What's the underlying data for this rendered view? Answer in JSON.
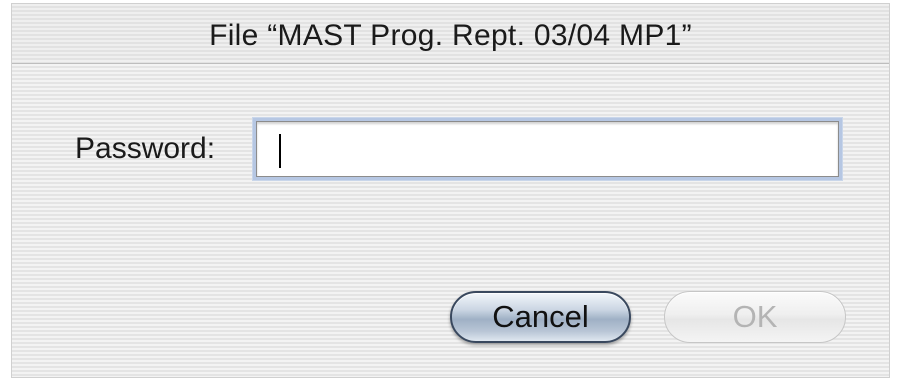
{
  "dialog": {
    "title": "File “MAST Prog. Rept. 03/04 MP1”"
  },
  "password": {
    "label": "Password:",
    "value": "",
    "placeholder": ""
  },
  "buttons": {
    "cancel_label": "Cancel",
    "ok_label": "OK",
    "ok_enabled": false
  },
  "colors": {
    "cancel_border": "#39485e",
    "ok_disabled_text": "#b4b4b4",
    "focus_ring": "#b6c7e3"
  }
}
